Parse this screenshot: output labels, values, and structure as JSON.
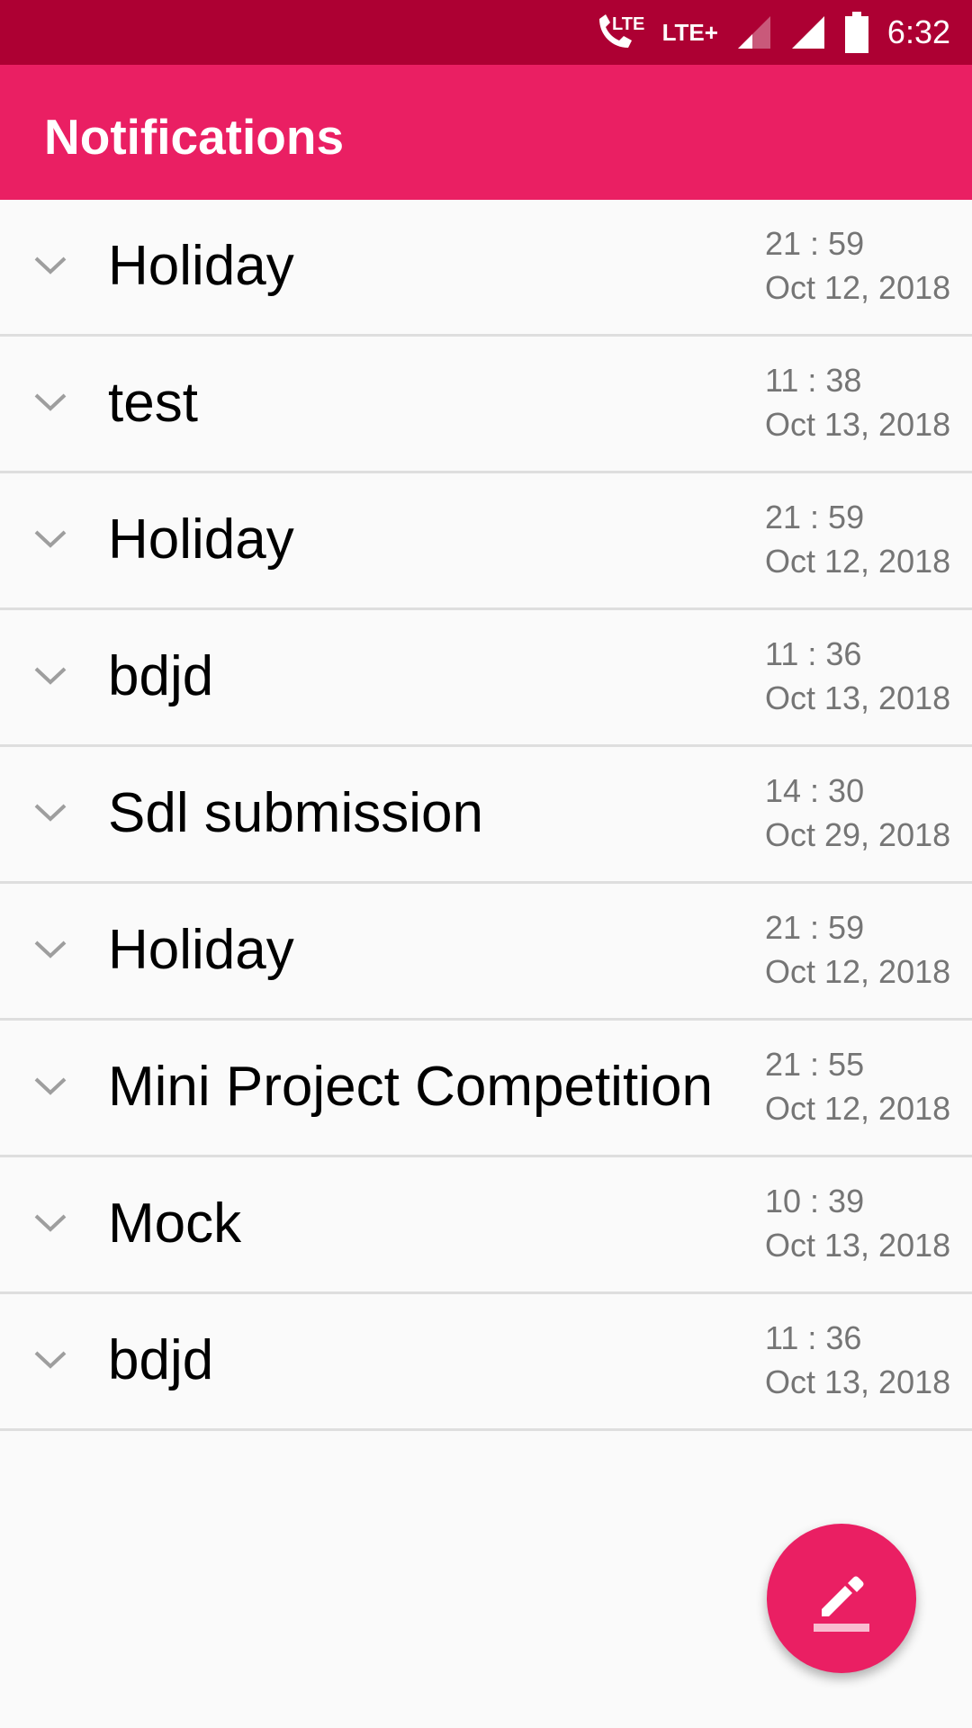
{
  "status_bar": {
    "time": "6:32",
    "icons": [
      "volte-call-icon",
      "lte-plus-icon",
      "signal-weak-icon",
      "signal-full-icon",
      "battery-icon"
    ],
    "volte_label": "LTE",
    "network_label": "LTE+"
  },
  "app_bar": {
    "title": "Notifications"
  },
  "notifications": [
    {
      "title": "Holiday",
      "time": "21 : 59",
      "date": "Oct 12, 2018"
    },
    {
      "title": "test",
      "time": "11 : 38",
      "date": "Oct 13, 2018"
    },
    {
      "title": "Holiday",
      "time": "21 : 59",
      "date": "Oct 12, 2018"
    },
    {
      "title": "bdjd",
      "time": "11 : 36",
      "date": "Oct 13, 2018"
    },
    {
      "title": "Sdl submission",
      "time": "14 : 30",
      "date": "Oct 29, 2018"
    },
    {
      "title": "Holiday",
      "time": "21 : 59",
      "date": "Oct 12, 2018"
    },
    {
      "title": "Mini Project Competition",
      "time": "21 : 55",
      "date": "Oct 12, 2018"
    },
    {
      "title": "Mock",
      "time": "10 : 39",
      "date": "Oct 13, 2018"
    },
    {
      "title": "bdjd",
      "time": "11 : 36",
      "date": "Oct 13, 2018"
    }
  ],
  "fab": {
    "icon": "edit-pencil-icon"
  },
  "colors": {
    "status_bar": "#ad0033",
    "primary": "#ea1f63",
    "secondary_text": "#757575"
  }
}
